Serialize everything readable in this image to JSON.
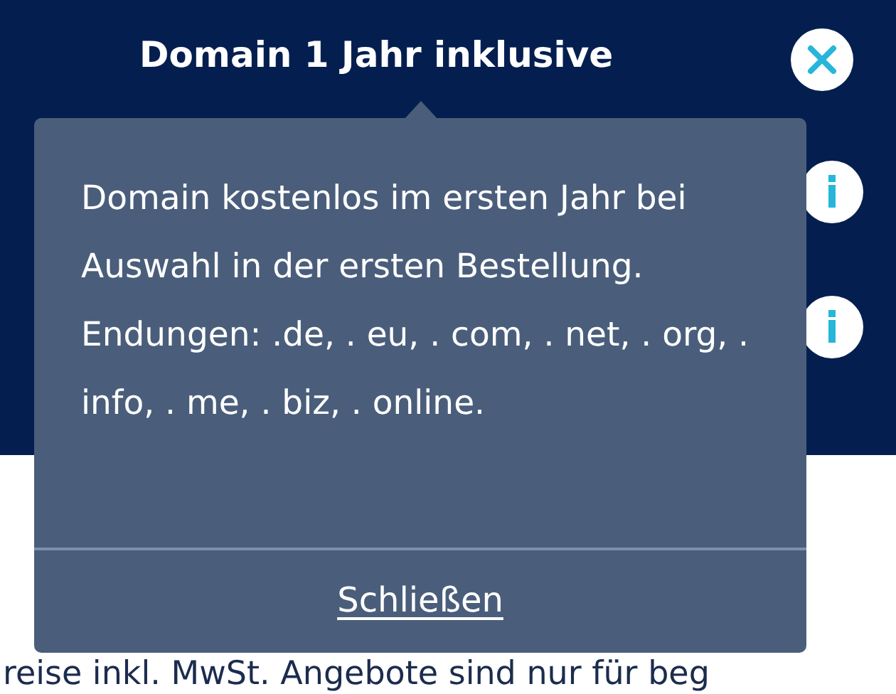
{
  "header": {
    "title": "Domain 1 Jahr inklusive"
  },
  "popover": {
    "text": "Domain kostenlos im ersten Jahr bei Auswahl in der ersten Bestellung. Endungen: .de, . eu, . com, . net, . org, . info, . me, . biz, . online.",
    "close_link": "Schließen"
  },
  "footer_text": "reise inkl. MwSt. Angebote sind nur für beg"
}
